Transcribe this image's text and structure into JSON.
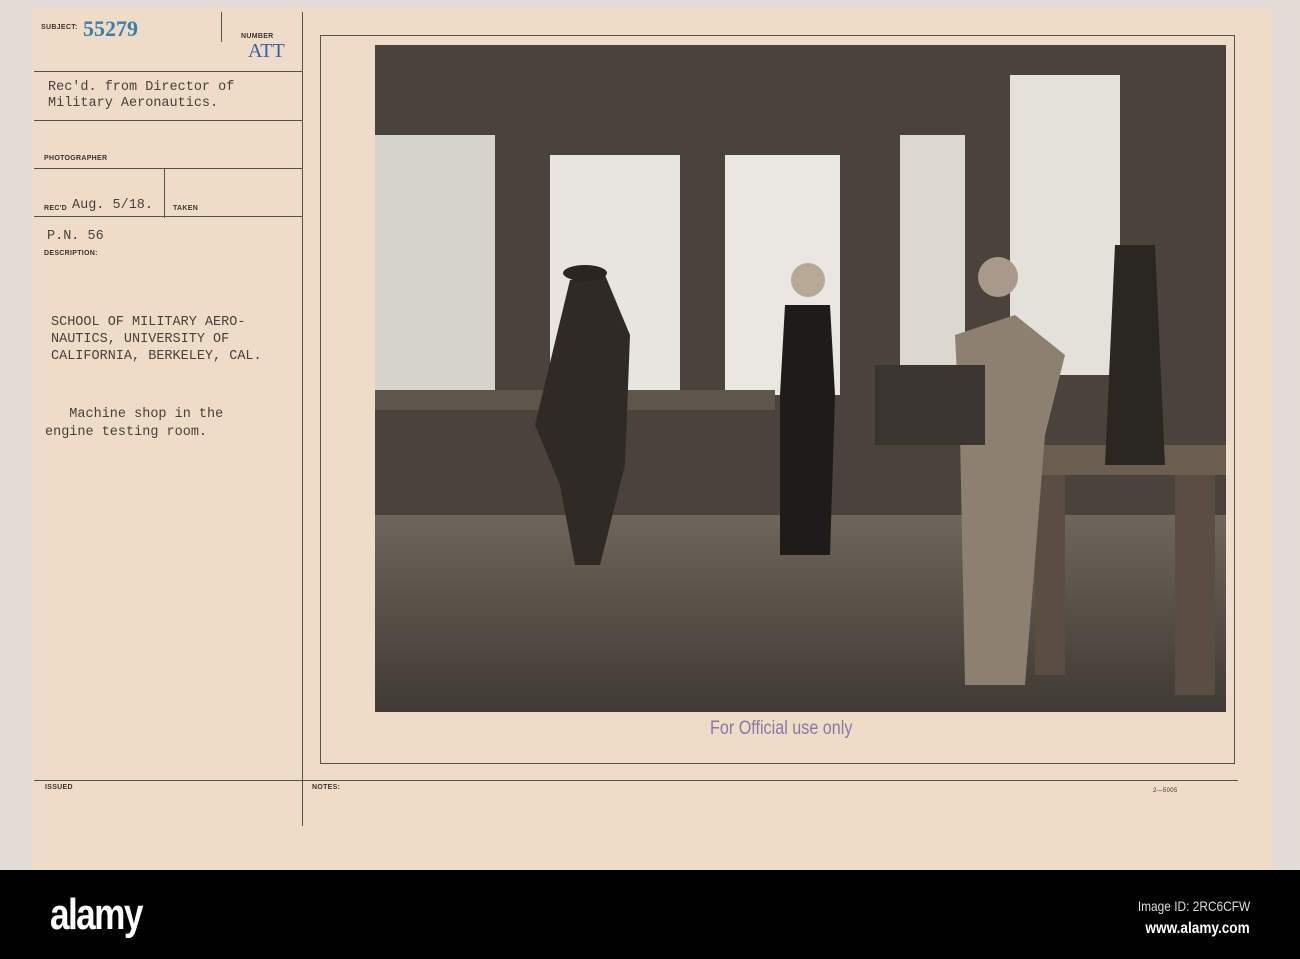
{
  "card": {
    "subject_label": "SUBJECT:",
    "subject_number": "55279",
    "number_label": "NUMBER",
    "number_value": "ATT",
    "received_from": "Rec'd. from Director of\nMilitary Aeronautics.",
    "photographer_label": "PHOTOGRAPHER",
    "recd_label": "REC'D",
    "recd_value": "Aug. 5/18.",
    "taken_label": "TAKEN",
    "pn": "P.N. 56",
    "description_label": "DESCRIPTION:",
    "description_title": "SCHOOL OF MILITARY AERO-\nNAUTICS, UNIVERSITY OF\nCALIFORNIA, BERKELEY, CAL.",
    "description_body": "   Machine shop in the\nengine testing room.",
    "stamp": "For Official use only",
    "issued_label": "ISSUED",
    "notes_label": "NOTES:",
    "form_number": "2—5005"
  },
  "banner": {
    "logo": "alamy",
    "image_id": "Image ID: 2RC6CFW",
    "website": "www.alamy.com"
  },
  "colors": {
    "card": "#eddcc8",
    "stamp_blue": "#3d7ea8",
    "official_purple": "#8a78a4"
  }
}
